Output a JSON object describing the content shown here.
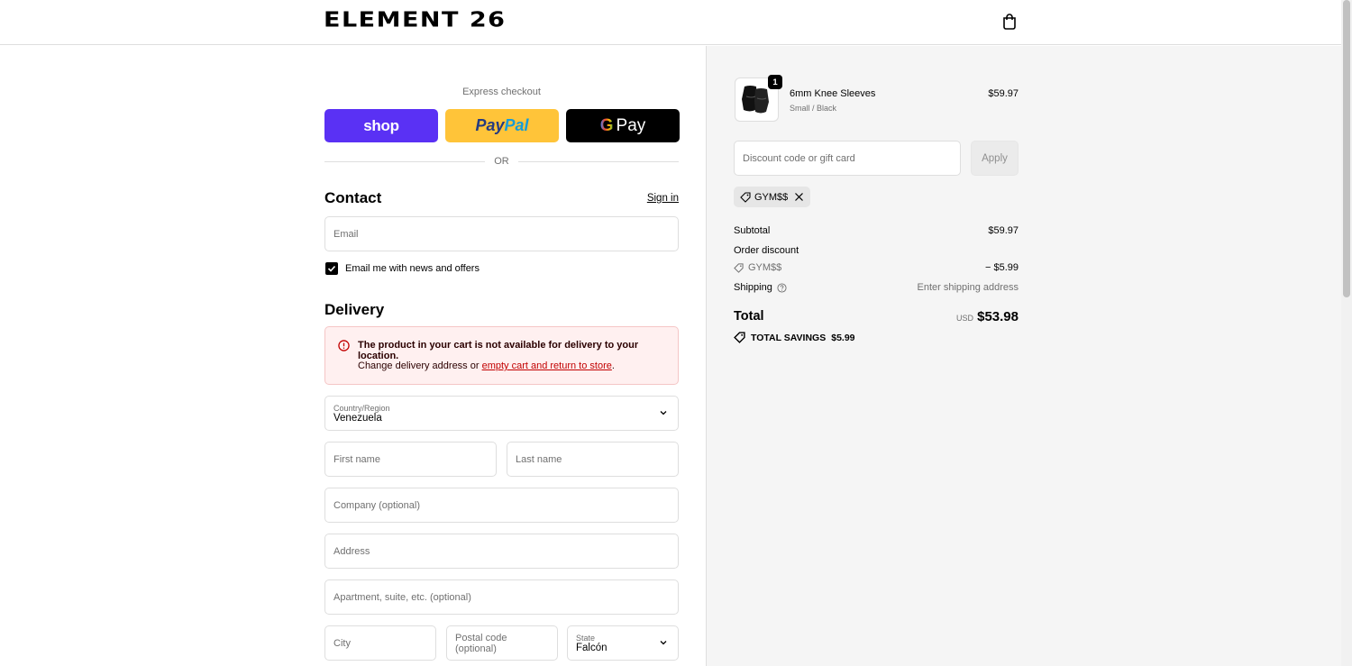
{
  "header": {
    "logo": "ELEMENT 26",
    "cart_icon": "shopping-bag-icon"
  },
  "express": {
    "label": "Express checkout",
    "shop_label": "shop",
    "paypal_label_1": "Pay",
    "paypal_label_2": "Pal",
    "gpay_g": "G",
    "gpay_label": "Pay",
    "or_label": "OR"
  },
  "contact": {
    "title": "Contact",
    "signin_label": "Sign in",
    "email_placeholder": "Email",
    "newsletter_label": "Email me with news and offers",
    "newsletter_checked": true
  },
  "delivery": {
    "title": "Delivery",
    "alert_title": "The product in your cart is not available for delivery to your location.",
    "alert_text": "Change delivery address or ",
    "alert_link": "empty cart and return to store",
    "alert_end": ".",
    "country_label": "Country/Region",
    "country_value": "Venezuela",
    "first_name": "First name",
    "last_name": "Last name",
    "company": "Company (optional)",
    "address": "Address",
    "apartment": "Apartment, suite, etc. (optional)",
    "city": "City",
    "postal": "Postal code (optional)",
    "state_label": "State",
    "state_value": "Falcón"
  },
  "summary": {
    "product_name": "6mm Knee Sleeves",
    "product_variant": "Small / Black",
    "product_price": "$59.97",
    "quantity": "1",
    "discount_placeholder": "Discount code or gift card",
    "apply_label": "Apply",
    "code_chip": "GYM$$",
    "subtotal_label": "Subtotal",
    "subtotal_value": "$59.97",
    "order_discount_label": "Order discount",
    "discount_code": "GYM$$",
    "discount_value": "− $5.99",
    "shipping_label": "Shipping",
    "shipping_value": "Enter shipping address",
    "total_label": "Total",
    "currency": "USD",
    "total_value": "$53.98",
    "savings_label": "TOTAL SAVINGS",
    "savings_value": "$5.99"
  }
}
